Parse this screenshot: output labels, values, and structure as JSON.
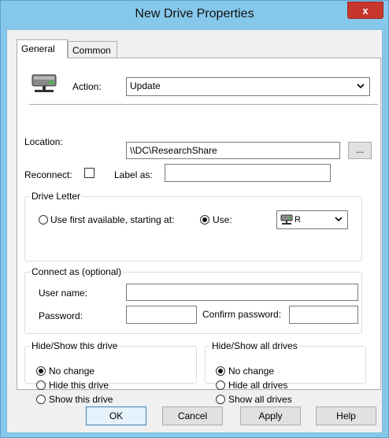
{
  "window": {
    "title": "New Drive Properties",
    "close_label": "x"
  },
  "tabs": [
    {
      "label": "General",
      "selected": true
    },
    {
      "label": "Common",
      "selected": false
    }
  ],
  "general": {
    "action_label": "Action:",
    "action_value": "Update",
    "location_label": "Location:",
    "location_value": "\\\\DC\\ResearchShare",
    "browse_label": "...",
    "reconnect_label": "Reconnect:",
    "reconnect_checked": false,
    "label_as_label": "Label as:",
    "label_as_value": "",
    "drive_letter": {
      "group_label": "Drive Letter",
      "first_available_label": "Use first available, starting at:",
      "use_label": "Use:",
      "selected_option": "use",
      "letter_value": "R"
    },
    "connect_as": {
      "group_label": "Connect as (optional)",
      "username_label": "User name:",
      "username_value": "",
      "password_label": "Password:",
      "password_value": "",
      "confirm_label": "Confirm password:",
      "confirm_value": ""
    },
    "hide_this": {
      "group_label": "Hide/Show this drive",
      "options": [
        "No change",
        "Hide this drive",
        "Show this drive"
      ],
      "selected": "No change"
    },
    "hide_all": {
      "group_label": "Hide/Show all drives",
      "options": [
        "No change",
        "Hide all drives",
        "Show all drives"
      ],
      "selected": "No change"
    }
  },
  "buttons": {
    "ok": "OK",
    "cancel": "Cancel",
    "apply": "Apply",
    "help": "Help"
  },
  "icons": {
    "action": "network-drive-icon",
    "drive_letter": "network-drive-icon"
  },
  "colors": {
    "title_bar": "#86c8ec",
    "close_button": "#c7362d",
    "default_button_border": "#3c7fb1"
  }
}
